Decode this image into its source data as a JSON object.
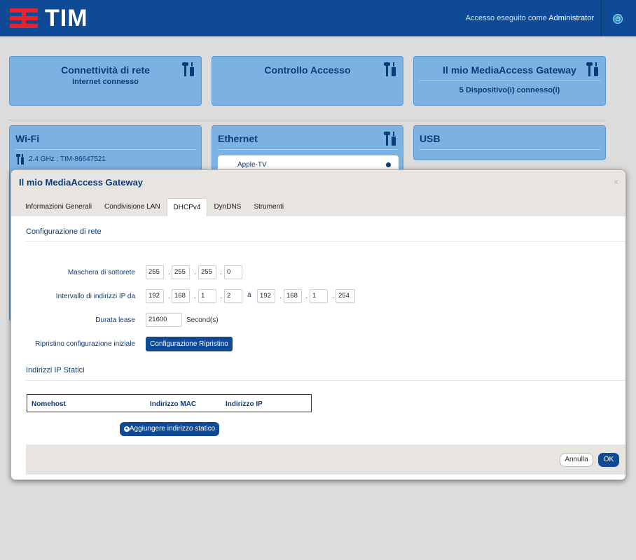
{
  "header": {
    "brand": "TIM",
    "login_prefix": "Accesso eseguito come",
    "login_user": "Administrator"
  },
  "cards": {
    "connectivity": {
      "title": "Connettività di rete",
      "subtitle": "Internet connesso"
    },
    "access_control": {
      "title": "Controllo Accesso"
    },
    "gateway": {
      "title": "Il mio MediaAccess Gateway",
      "subtitle": "5 Dispositivo(i) connesso(i)"
    },
    "wifi": {
      "title": "Wi-Fi",
      "line": "2.4 GHz : TIM-86647521"
    },
    "ethernet": {
      "title": "Ethernet",
      "device": "Apple-TV"
    },
    "usb": {
      "title": "USB"
    }
  },
  "modal": {
    "title": "Il mio MediaAccess Gateway",
    "close": "×",
    "tabs": [
      "Informazioni Generali",
      "Condivisione LAN",
      "DHCPv4",
      "DynDNS",
      "Strumenti"
    ],
    "active_tab": "DHCPv4",
    "network_section": "Configurazione di rete",
    "subnet_label": "Maschera di sottorete",
    "subnet": [
      "255",
      "255",
      "255",
      "0"
    ],
    "range_label": "Intervallo di indirizzi IP da",
    "range_from": [
      "192",
      "168",
      "1",
      "2"
    ],
    "range_to_word": "a",
    "range_to": [
      "192",
      "168",
      "1",
      "254"
    ],
    "lease_label": "Durata lease",
    "lease_value": "21600",
    "lease_unit": "Second(s)",
    "reset_label": "Ripristino configurazione iniziale",
    "reset_button": "Configurazione Ripristino",
    "static_section": "Indirizzi IP Statici",
    "table_headers": [
      "Nomehost",
      "Indirizzo MAC",
      "Indirizzo IP"
    ],
    "add_static": "Aggiungere indirizzo statico",
    "cancel": "Annulla",
    "ok": "OK"
  },
  "colors": {
    "header_blue": "#0e4a96",
    "brand_red": "#e8222a",
    "card_blue": "#7bb2e2",
    "text_blue": "#0a3c7a"
  },
  "icons": [
    "tools-icon",
    "settings-icon",
    "power-icon",
    "close-icon",
    "plus-circle-icon"
  ]
}
